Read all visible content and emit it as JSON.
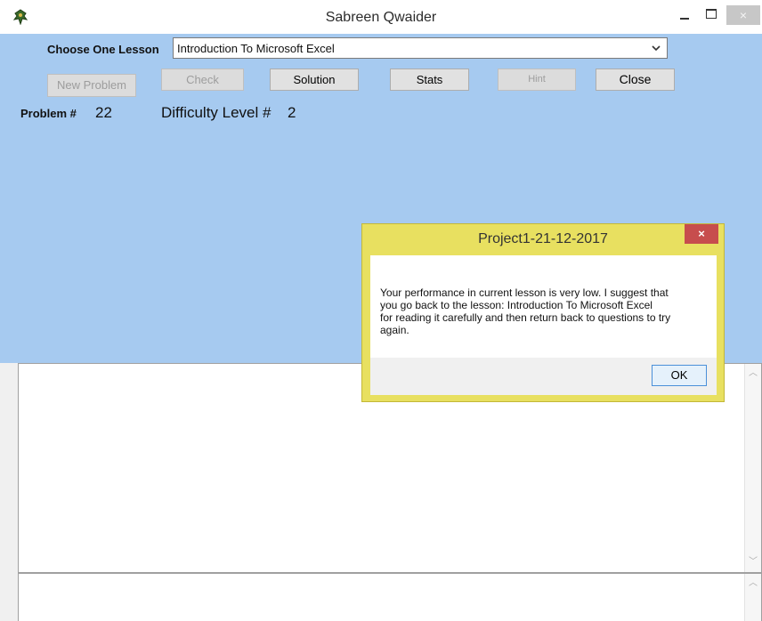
{
  "window": {
    "title": "Sabreen Qwaider",
    "icon": "app-icon",
    "controls": {
      "minimize": "minimize-icon",
      "maximize": "maximize-icon",
      "close": "×"
    }
  },
  "lesson": {
    "label": "Choose One Lesson",
    "selected": "Introduction To Microsoft Excel"
  },
  "buttons": {
    "new_problem": "New Problem",
    "check": "Check",
    "solution": "Solution",
    "stats": "Stats",
    "hint": "Hint",
    "close": "Close"
  },
  "problem": {
    "label": "Problem #",
    "number": "22",
    "difficulty_label": "Difficulty Level #",
    "difficulty": "2"
  },
  "dialog": {
    "title": "Project1-21-12-2017",
    "close": "×",
    "message": "Your performance in current lesson is very low. I suggest that\nyou go back to the lesson: Introduction To Microsoft Excel\n for reading it carefully and then return back to questions to try\nagain.",
    "ok": "OK"
  },
  "colors": {
    "form_background": "#a6caf0",
    "dialog_frame": "#e8e060",
    "dialog_close": "#c74d4d"
  }
}
